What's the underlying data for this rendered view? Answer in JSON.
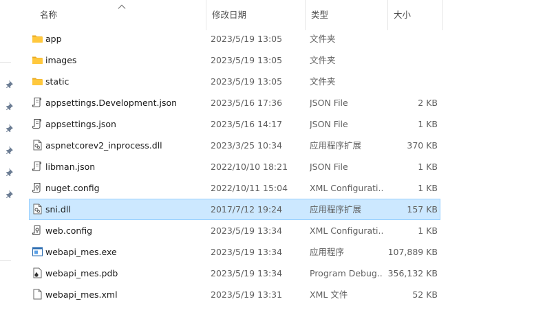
{
  "columns": {
    "name": "名称",
    "date": "修改日期",
    "type": "类型",
    "size": "大小"
  },
  "sort": {
    "column": "name",
    "direction": "ascending"
  },
  "selected_row": 8,
  "files": [
    {
      "icon": "folder-icon",
      "name": "app",
      "date": "2023/5/19 13:05",
      "type": "文件夹",
      "size": ""
    },
    {
      "icon": "folder-icon",
      "name": "images",
      "date": "2023/5/19 13:05",
      "type": "文件夹",
      "size": ""
    },
    {
      "icon": "folder-icon",
      "name": "static",
      "date": "2023/5/19 13:05",
      "type": "文件夹",
      "size": ""
    },
    {
      "icon": "json-file-icon",
      "name": "appsettings.Development.json",
      "date": "2023/5/16 17:36",
      "type": "JSON File",
      "size": "2 KB"
    },
    {
      "icon": "json-file-icon",
      "name": "appsettings.json",
      "date": "2023/5/16 14:17",
      "type": "JSON File",
      "size": "1 KB"
    },
    {
      "icon": "dll-file-icon",
      "name": "aspnetcorev2_inprocess.dll",
      "date": "2023/3/25 10:34",
      "type": "应用程序扩展",
      "size": "370 KB"
    },
    {
      "icon": "json-file-icon",
      "name": "libman.json",
      "date": "2022/10/10 18:21",
      "type": "JSON File",
      "size": "1 KB"
    },
    {
      "icon": "config-file-icon",
      "name": "nuget.config",
      "date": "2022/10/11 15:04",
      "type": "XML Configurati...",
      "size": "1 KB"
    },
    {
      "icon": "dll-file-icon",
      "name": "sni.dll",
      "date": "2017/7/12 19:24",
      "type": "应用程序扩展",
      "size": "157 KB"
    },
    {
      "icon": "config-file-icon",
      "name": "web.config",
      "date": "2023/5/19 13:34",
      "type": "XML Configurati...",
      "size": "1 KB"
    },
    {
      "icon": "exe-file-icon",
      "name": "webapi_mes.exe",
      "date": "2023/5/19 13:34",
      "type": "应用程序",
      "size": "107,889 KB"
    },
    {
      "icon": "pdb-file-icon",
      "name": "webapi_mes.pdb",
      "date": "2023/5/19 13:34",
      "type": "Program Debug...",
      "size": "356,132 KB"
    },
    {
      "icon": "xml-file-icon",
      "name": "webapi_mes.xml",
      "date": "2023/5/19 13:31",
      "type": "XML 文件",
      "size": "52 KB"
    }
  ],
  "colors": {
    "folder": "#f5c242",
    "selection_bg": "#cce8ff",
    "selection_border": "#99d1ff",
    "header_text": "#4c4c4c"
  }
}
